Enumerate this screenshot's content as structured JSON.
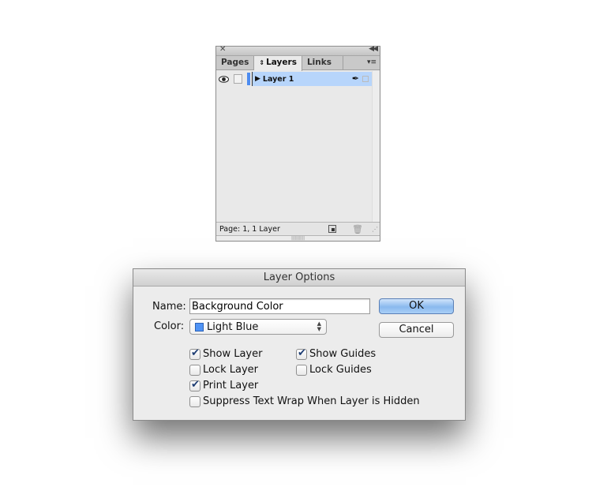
{
  "layers_panel": {
    "close_icon": "close-icon",
    "collapse_icon": "double-chevron-left-icon",
    "tabs": [
      {
        "label": "Pages",
        "active": false
      },
      {
        "label": "Layers",
        "active": true,
        "prefix_icon": "up-down-arrows-icon"
      },
      {
        "label": "Links",
        "active": false
      }
    ],
    "menu_icon": "panel-menu-icon",
    "layers": [
      {
        "name": "Layer 1",
        "visible": true,
        "locked": false,
        "color": "#4d8cf0",
        "selected": true
      }
    ],
    "footer": {
      "status": "Page: 1, 1 Layer",
      "new_layer_icon": "new-layer-icon",
      "delete_icon": "trash-icon"
    }
  },
  "dialog": {
    "title": "Layer Options",
    "name_label": "Name:",
    "name_value": "Background Color",
    "color_label": "Color:",
    "color_value": "Light Blue",
    "color_swatch": "#4f93f5",
    "ok_label": "OK",
    "cancel_label": "Cancel",
    "checkboxes": {
      "show_layer": {
        "label": "Show Layer",
        "checked": true
      },
      "show_guides": {
        "label": "Show Guides",
        "checked": true
      },
      "lock_layer": {
        "label": "Lock Layer",
        "checked": false
      },
      "lock_guides": {
        "label": "Lock Guides",
        "checked": false
      },
      "print_layer": {
        "label": "Print Layer",
        "checked": true
      },
      "suppress_text_wrap": {
        "label": "Suppress Text Wrap When Layer is Hidden",
        "checked": false
      }
    }
  }
}
